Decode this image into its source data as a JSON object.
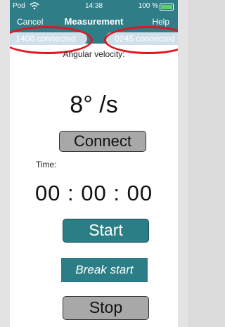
{
  "status_bar": {
    "carrier": "Pod",
    "time": "14:38",
    "battery_text": "100 %"
  },
  "nav": {
    "cancel_label": "Cancel",
    "title": "Measurement",
    "help_label": "Help"
  },
  "connections": {
    "left_label": "1400 connected",
    "right_label": "0245 connected"
  },
  "measurement": {
    "angular_label": "Angular velocity:",
    "angular_value": "8° /s"
  },
  "buttons": {
    "connect_label": "Connect",
    "start_label": "Start",
    "break_label": "Break start",
    "stop_label": "Stop"
  },
  "timer": {
    "label": "Time:",
    "value": "00 : 00 : 00"
  },
  "colors": {
    "header": "#2f7d86",
    "highlight_ellipse": "#e1141f",
    "button_gray": "#a8a8a8",
    "button_teal": "#2b7d86"
  }
}
